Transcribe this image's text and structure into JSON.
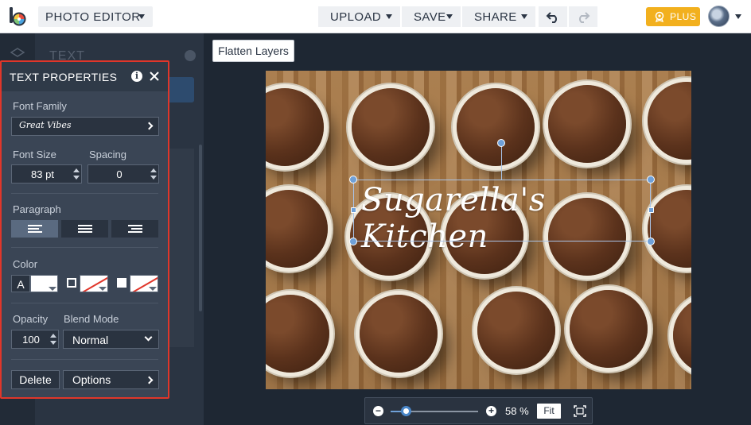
{
  "topbar": {
    "editor_label": "PHOTO EDITOR",
    "menus": [
      {
        "label": "UPLOAD",
        "name": "upload-menu-button",
        "width": 103
      },
      {
        "label": "SAVE",
        "name": "save-menu-button",
        "width": 74
      },
      {
        "label": "SHARE",
        "name": "share-menu-button",
        "width": 92
      }
    ],
    "plus_label": "PLUS",
    "accent_color": "#f2b01e"
  },
  "sidebar_dim": {
    "title": "TEXT"
  },
  "panel": {
    "title": "TEXT PROPERTIES",
    "info_glyph": "i",
    "font_family_label": "Font Family",
    "font_family_value": "Great Vibes",
    "font_size_label": "Font Size",
    "font_size_value": "83 pt",
    "spacing_label": "Spacing",
    "spacing_value": "0",
    "paragraph_label": "Paragraph",
    "alignment_selected": "left",
    "color_label": "Color",
    "color_text_glyph": "A",
    "text_color": "#ffffff",
    "opacity_label": "Opacity",
    "opacity_value": "100",
    "blend_label": "Blend Mode",
    "blend_value": "Normal",
    "delete_label": "Delete",
    "options_label": "Options",
    "highlight_color": "#e0362a"
  },
  "canvas": {
    "flatten_label": "Flatten Layers",
    "overlay_text": "Sugarella's Kitchen"
  },
  "zoom": {
    "minus_glyph": "−",
    "plus_glyph": "+",
    "level": 0.58,
    "value_label": "58 %",
    "fit_label": "Fit"
  }
}
